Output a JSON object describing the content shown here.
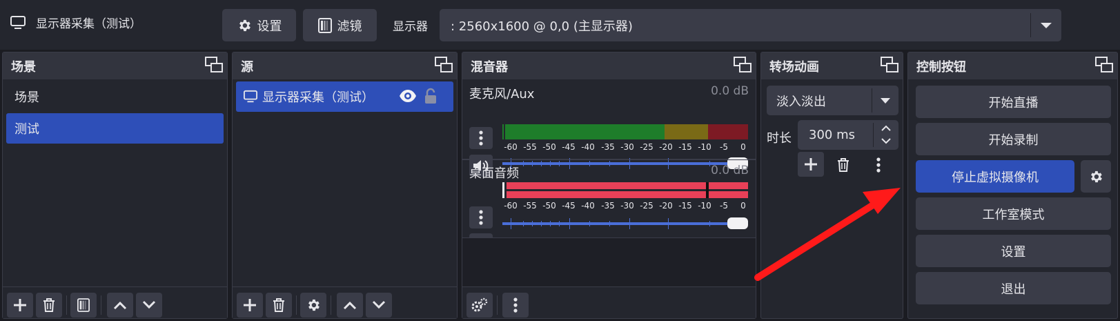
{
  "topbar": {
    "source_title": "显示器采集（测试）",
    "settings_label": "设置",
    "filters_label": "滤镜",
    "display_label": "显示器",
    "display_value": ": 2560x1600 @ 0,0 (主显示器)"
  },
  "scenes": {
    "title": "场景",
    "items": [
      {
        "label": "场景",
        "selected": false
      },
      {
        "label": "测试",
        "selected": true
      }
    ]
  },
  "sources": {
    "title": "源",
    "items": [
      {
        "label": "显示器采集（测试）",
        "selected": true
      }
    ]
  },
  "mixer": {
    "title": "混音器",
    "channels": [
      {
        "name": "麦克风/Aux",
        "db": "0.0 dB"
      },
      {
        "name": "桌面音频",
        "db": "0.0 dB"
      }
    ],
    "ticks": [
      "-60",
      "-55",
      "-50",
      "-45",
      "-40",
      "-35",
      "-30",
      "-25",
      "-20",
      "-15",
      "-10",
      "-5",
      "0"
    ]
  },
  "transitions": {
    "title": "转场动画",
    "selected": "淡入淡出",
    "duration_label": "时长",
    "duration_value": "300 ms"
  },
  "controls": {
    "title": "控制按钮",
    "start_stream": "开始直播",
    "start_record": "开始录制",
    "stop_virtual_cam": "停止虚拟摄像机",
    "studio_mode": "工作室模式",
    "settings": "设置",
    "exit": "退出"
  },
  "colors": {
    "accent": "#2e4fb8",
    "annotation_arrow": "#ff1a1a",
    "meter_green": "#1e7d2a",
    "meter_yellow": "#7a6a16",
    "meter_red": "#7d1a24",
    "meter_active": "#e84058"
  }
}
